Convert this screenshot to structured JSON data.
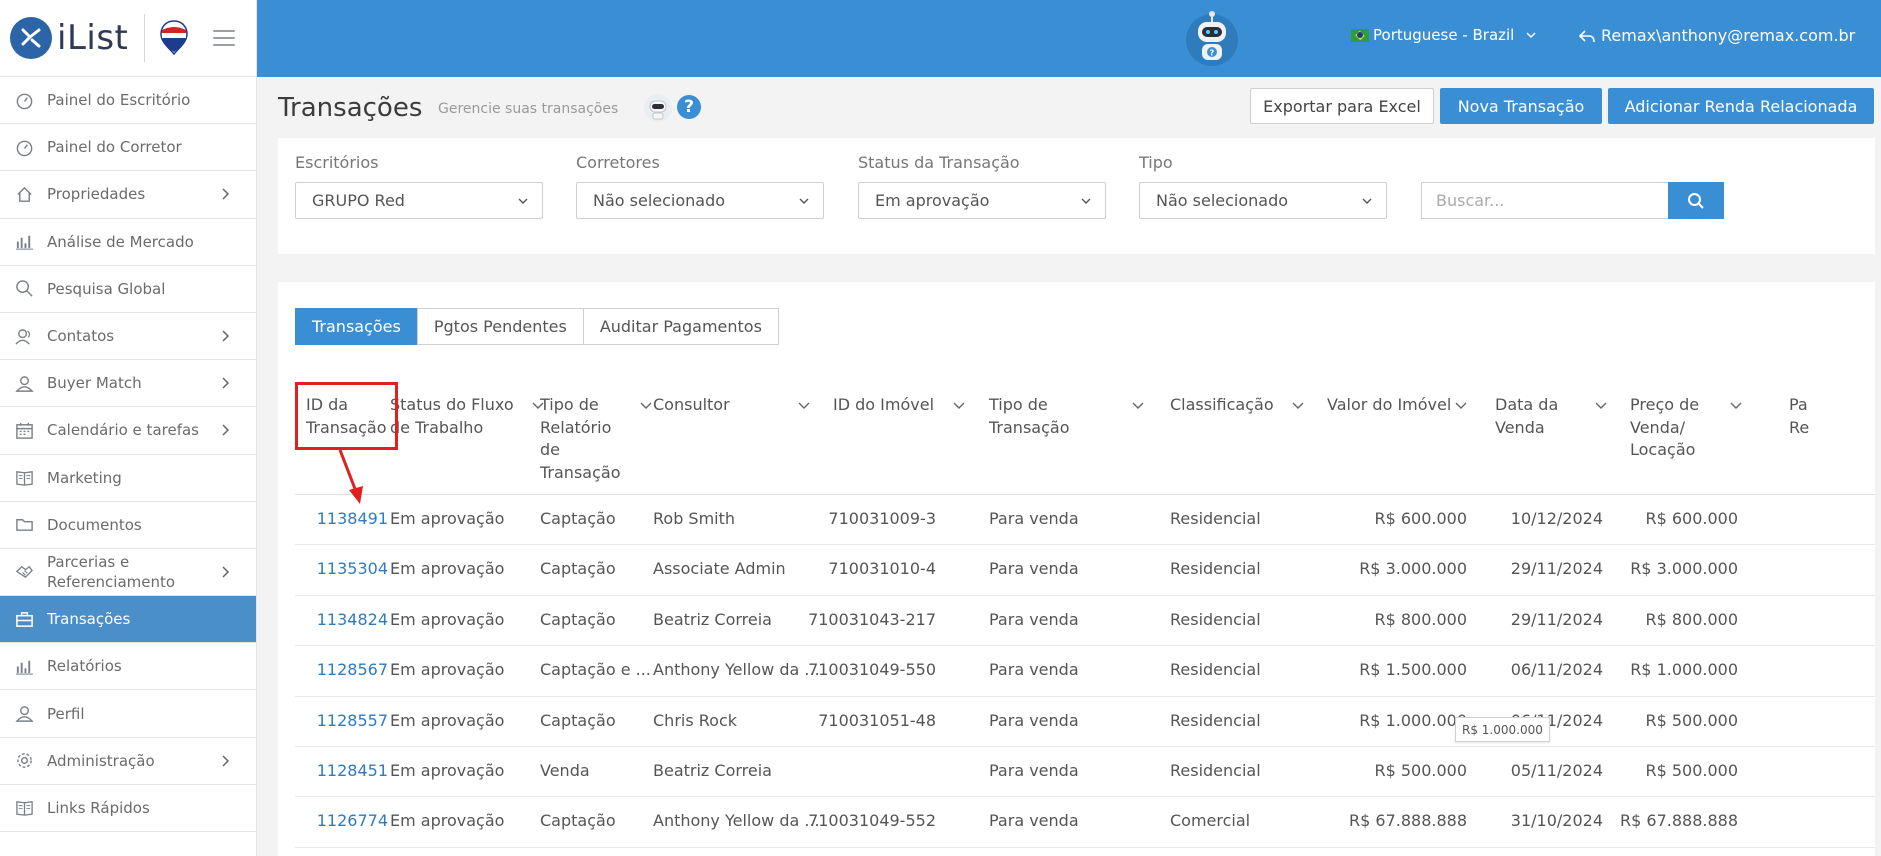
{
  "brand": {
    "name": "iList"
  },
  "sidebar": {
    "items": [
      {
        "label": "Painel do Escritório",
        "icon": "gauge-icon",
        "has_children": false
      },
      {
        "label": "Painel do Corretor",
        "icon": "gauge-icon",
        "has_children": false
      },
      {
        "label": "Propriedades",
        "icon": "home-icon",
        "has_children": true
      },
      {
        "label": "Análise de Mercado",
        "icon": "bar-chart-icon",
        "has_children": false
      },
      {
        "label": "Pesquisa Global",
        "icon": "search-icon",
        "has_children": false
      },
      {
        "label": "Contatos",
        "icon": "contacts-icon",
        "has_children": true
      },
      {
        "label": "Buyer Match",
        "icon": "user-icon",
        "has_children": true
      },
      {
        "label": "Calendário e tarefas",
        "icon": "calendar-icon",
        "has_children": true
      },
      {
        "label": "Marketing",
        "icon": "book-icon",
        "has_children": false
      },
      {
        "label": "Documentos",
        "icon": "folder-icon",
        "has_children": false
      },
      {
        "label": "Parcerias e Referenciamento",
        "icon": "handshake-icon",
        "has_children": true
      },
      {
        "label": "Transações",
        "icon": "briefcase-icon",
        "has_children": false,
        "active": true
      },
      {
        "label": "Relatórios",
        "icon": "bar-chart-icon",
        "has_children": false
      },
      {
        "label": "Perfil",
        "icon": "user-icon",
        "has_children": false
      },
      {
        "label": "Administração",
        "icon": "gear-icon",
        "has_children": true
      },
      {
        "label": "Links Rápidos",
        "icon": "book-icon",
        "has_children": false
      }
    ]
  },
  "topbar": {
    "language": "Portuguese - Brazil",
    "user": "Remax\\anthony@remax.com.br"
  },
  "header": {
    "title": "Transações",
    "subtitle": "Gerencie suas transações",
    "export_label": "Exportar para Excel",
    "new_label": "Nova Transação",
    "related_label": "Adicionar Renda Relacionada"
  },
  "filters": {
    "offices": {
      "label": "Escritórios",
      "value": "GRUPO Red"
    },
    "brokers": {
      "label": "Corretores",
      "value": "Não selecionado"
    },
    "status": {
      "label": "Status da Transação",
      "value": "Em aprovação"
    },
    "type": {
      "label": "Tipo",
      "value": "Não selecionado"
    },
    "search_placeholder": "Buscar..."
  },
  "tabs": [
    "Transações",
    "Pgtos Pendentes",
    "Auditar Pagamentos"
  ],
  "table": {
    "columns": [
      "ID da Transação",
      "Status do Fluxo de Trabalho",
      "Tipo de Relatório de Transação",
      "Consultor",
      "ID do Imóvel",
      "Tipo de Transação",
      "Classificação",
      "Valor do Imóvel",
      "Data da Venda",
      "Preço de Venda/ Locação",
      "Pa Re"
    ],
    "rows": [
      [
        "1138491",
        "Em aprovação",
        "Captação",
        "Rob Smith",
        "710031009-3",
        "Para venda",
        "Residencial",
        "R$ 600.000",
        "10/12/2024",
        "R$ 600.000"
      ],
      [
        "1135304",
        "Em aprovação",
        "Captação",
        "Associate Admin",
        "710031010-4",
        "Para venda",
        "Residencial",
        "R$ 3.000.000",
        "29/11/2024",
        "R$ 3.000.000"
      ],
      [
        "1134824",
        "Em aprovação",
        "Captação",
        "Beatriz Correia",
        "710031043-217",
        "Para venda",
        "Residencial",
        "R$ 800.000",
        "29/11/2024",
        "R$ 800.000"
      ],
      [
        "1128567",
        "Em aprovação",
        "Captação e ...",
        "Anthony Yellow da ...",
        "710031049-550",
        "Para venda",
        "Residencial",
        "R$ 1.500.000",
        "06/11/2024",
        "R$ 1.000.000"
      ],
      [
        "1128557",
        "Em aprovação",
        "Captação",
        "Chris Rock",
        "710031051-48",
        "Para venda",
        "Residencial",
        "R$ 1.000.000",
        "06/11/2024",
        "R$ 500.000"
      ],
      [
        "1128451",
        "Em aprovação",
        "Venda",
        "Beatriz Correia",
        "",
        "Para venda",
        "Residencial",
        "R$ 500.000",
        "05/11/2024",
        "R$ 500.000"
      ],
      [
        "1126774",
        "Em aprovação",
        "Captação",
        "Anthony Yellow da ...",
        "710031049-552",
        "Para venda",
        "Comercial",
        "R$ 67.888.888",
        "31/10/2024",
        "R$ 67.888.888"
      ]
    ],
    "tooltip": "R$ 1.000.000"
  },
  "colors": {
    "primary": "#3a8fd4",
    "sidebar_active": "#4b8fc9",
    "highlight": "#e02020"
  }
}
